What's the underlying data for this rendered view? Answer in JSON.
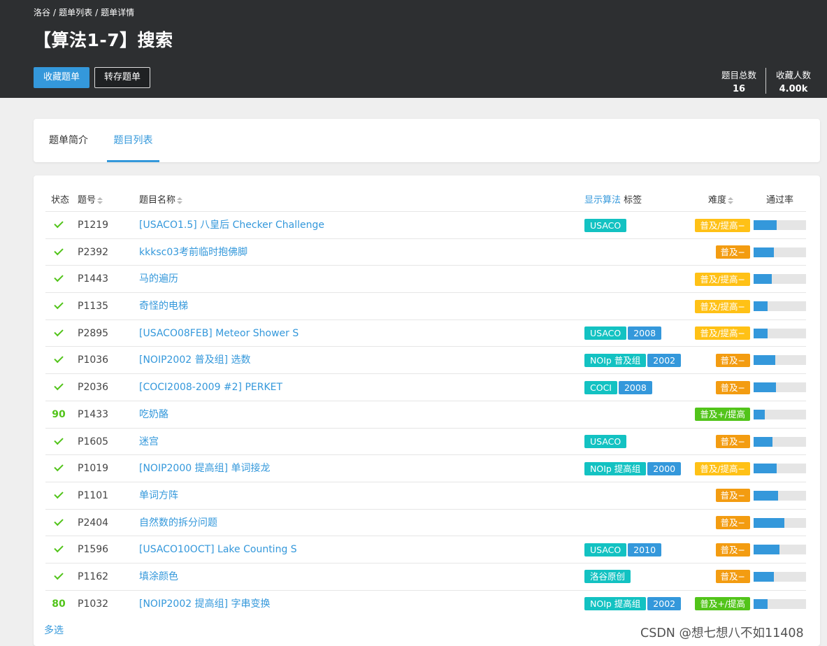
{
  "breadcrumb": [
    "洛谷",
    "题单列表",
    "题单详情"
  ],
  "title": "【算法1-7】搜索",
  "buttons": {
    "favorite": "收藏题单",
    "save": "转存题单"
  },
  "stats": {
    "total_label": "题目总数",
    "total_value": "16",
    "fav_label": "收藏人数",
    "fav_value": "4.00k"
  },
  "tabs": {
    "intro": "题单简介",
    "list": "题目列表"
  },
  "columns": {
    "status": "状态",
    "pid": "题号",
    "name": "题目名称",
    "show_algo": "显示算法",
    "tags": "标签",
    "difficulty": "难度",
    "pass_rate": "通过率"
  },
  "difficulty_colors": {
    "普及/提高−": "#ffc116",
    "普及−": "#f39c11",
    "普及+/提高": "#52c41a"
  },
  "problems": [
    {
      "status": "check",
      "pid": "P1219",
      "name": "[USACO1.5] 八皇后 Checker Challenge",
      "tags": [
        "USACO"
      ],
      "difficulty": "普及/提高−",
      "pass": 0.44
    },
    {
      "status": "check",
      "pid": "P2392",
      "name": "kkksc03考前临时抱佛脚",
      "tags": [],
      "difficulty": "普及−",
      "pass": 0.38
    },
    {
      "status": "check",
      "pid": "P1443",
      "name": "马的遍历",
      "tags": [],
      "difficulty": "普及/提高−",
      "pass": 0.35
    },
    {
      "status": "check",
      "pid": "P1135",
      "name": "奇怪的电梯",
      "tags": [],
      "difficulty": "普及/提高−",
      "pass": 0.26
    },
    {
      "status": "check",
      "pid": "P2895",
      "name": "[USACO08FEB] Meteor Shower S",
      "tags": [
        "USACO",
        "2008"
      ],
      "difficulty": "普及/提高−",
      "pass": 0.26
    },
    {
      "status": "check",
      "pid": "P1036",
      "name": "[NOIP2002 普及组] 选数",
      "tags": [
        "NOIp 普及组",
        "2002"
      ],
      "difficulty": "普及−",
      "pass": 0.41
    },
    {
      "status": "check",
      "pid": "P2036",
      "name": "[COCI2008-2009 #2] PERKET",
      "tags": [
        "COCI",
        "2008"
      ],
      "difficulty": "普及−",
      "pass": 0.43
    },
    {
      "status": "90",
      "pid": "P1433",
      "name": "吃奶酪",
      "tags": [],
      "difficulty": "普及+/提高",
      "pass": 0.21
    },
    {
      "status": "check",
      "pid": "P1605",
      "name": "迷宫",
      "tags": [
        "USACO"
      ],
      "difficulty": "普及−",
      "pass": 0.36
    },
    {
      "status": "check",
      "pid": "P1019",
      "name": "[NOIP2000 提高组] 单词接龙",
      "tags": [
        "NOIp 提高组",
        "2000"
      ],
      "difficulty": "普及/提高−",
      "pass": 0.44
    },
    {
      "status": "check",
      "pid": "P1101",
      "name": "单词方阵",
      "tags": [],
      "difficulty": "普及−",
      "pass": 0.46
    },
    {
      "status": "check",
      "pid": "P2404",
      "name": "自然数的拆分问题",
      "tags": [],
      "difficulty": "普及−",
      "pass": 0.59
    },
    {
      "status": "check",
      "pid": "P1596",
      "name": "[USACO10OCT] Lake Counting S",
      "tags": [
        "USACO",
        "2010"
      ],
      "difficulty": "普及−",
      "pass": 0.49
    },
    {
      "status": "check",
      "pid": "P1162",
      "name": "填涂颜色",
      "tags": [
        "洛谷原创"
      ],
      "difficulty": "普及−",
      "pass": 0.38
    },
    {
      "status": "80",
      "pid": "P1032",
      "name": "[NOIP2002 提高组] 字串变换",
      "tags": [
        "NOIp 提高组",
        "2002"
      ],
      "difficulty": "普及+/提高",
      "pass": 0.27
    }
  ],
  "multi_select": "多选",
  "watermark": "CSDN @想七想八不如11408"
}
